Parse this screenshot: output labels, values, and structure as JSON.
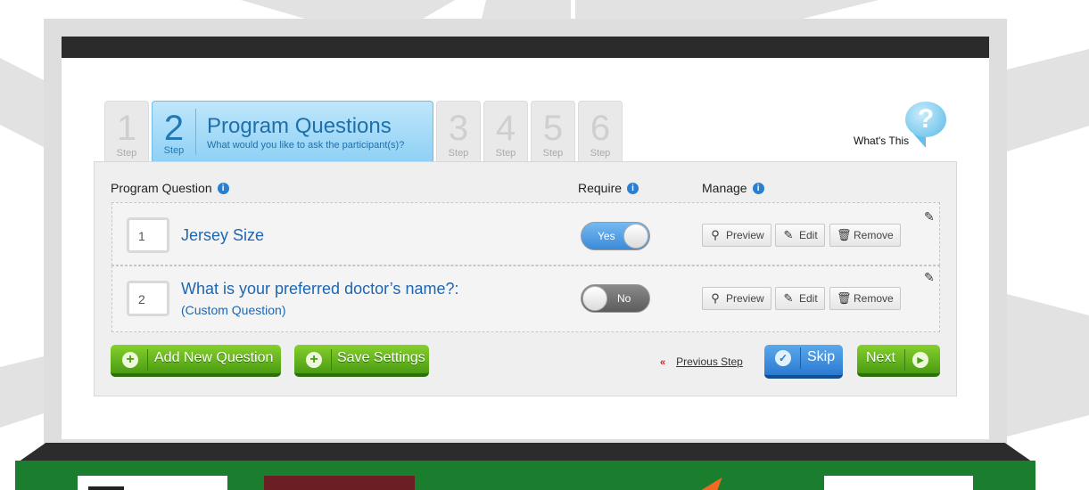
{
  "wizard": {
    "steps": [
      {
        "number": "1",
        "label": "Step"
      },
      {
        "number": "2",
        "label": "Step",
        "title": "Program Questions",
        "subtitle": "What would you like to ask the participant(s)?"
      },
      {
        "number": "3",
        "label": "Step"
      },
      {
        "number": "4",
        "label": "Step"
      },
      {
        "number": "5",
        "label": "Step"
      },
      {
        "number": "6",
        "label": "Step"
      }
    ],
    "active_step": 2,
    "whats_this": "What's This"
  },
  "table": {
    "headers": {
      "question": "Program Question",
      "require": "Require",
      "manage": "Manage"
    },
    "rows": [
      {
        "number": "1",
        "question": "Jersey Size",
        "subtitle": "",
        "require": "Yes",
        "require_on": true
      },
      {
        "number": "2",
        "question": "What is your preferred doctor’s name?:",
        "subtitle": "(Custom Question)",
        "require": "No",
        "require_on": false
      }
    ],
    "actions": {
      "preview": "Preview",
      "edit": "Edit",
      "remove": "Remove"
    }
  },
  "footer_buttons": {
    "add_question": "Add New Question",
    "save_settings": "Save Settings",
    "previous_step": "Previous Step",
    "skip": "Skip",
    "next": "Next"
  },
  "icons": {
    "info": "info-icon",
    "help": "question-bubble-icon",
    "preview": "magnifier-icon",
    "edit": "pencil-icon",
    "remove": "trash-icon",
    "add": "plus-circle-icon",
    "skip": "check-circle-icon",
    "next": "play-circle-icon",
    "previous": "double-chevron-left-icon"
  },
  "colors": {
    "accent_blue": "#2278b5",
    "green_button": "#5fb11c",
    "blue_button": "#2b7ad0",
    "footer_green": "#1b7e2f"
  }
}
